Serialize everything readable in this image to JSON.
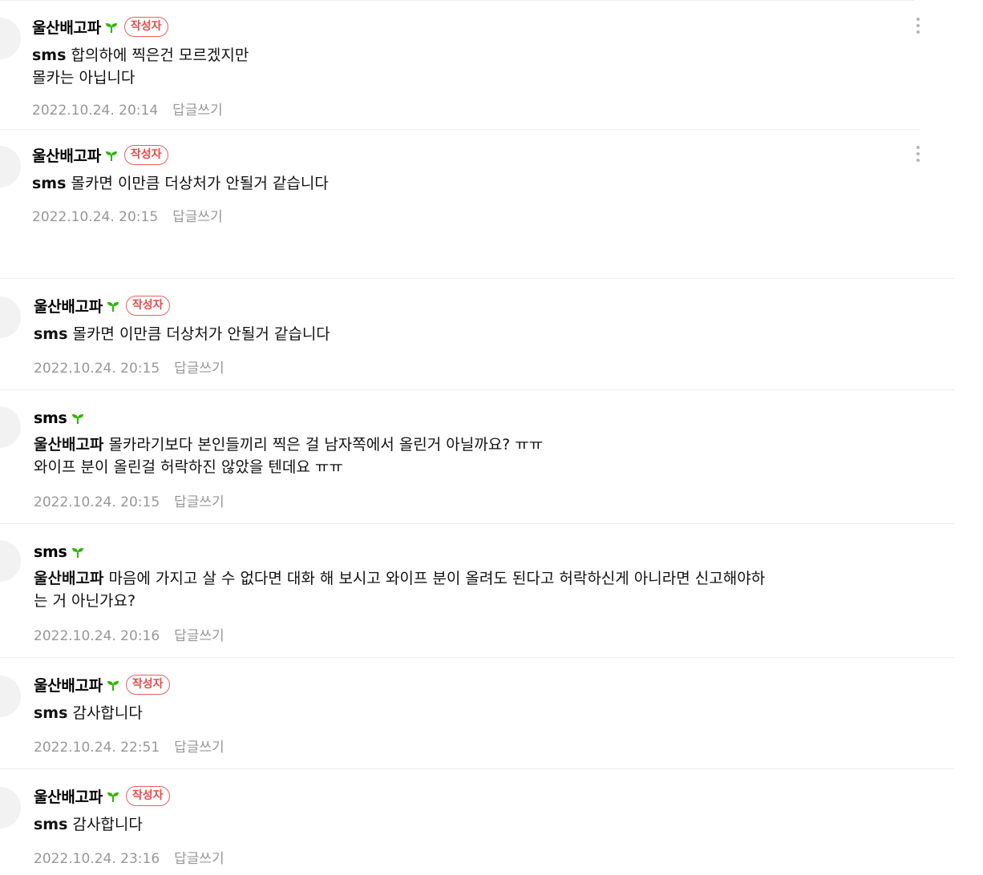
{
  "author_badge": "작성자",
  "reply_label": "답글쓰기",
  "comments": [
    {
      "nickname": "울산배고파",
      "is_author": true,
      "mention": "sms",
      "lines": [
        "합의하에 찍은건 모르겠지만",
        "몰카는 아닙니다"
      ],
      "date": "2022.10.24. 20:14"
    },
    {
      "nickname": "울산배고파",
      "is_author": true,
      "mention": "sms",
      "lines": [
        "몰카면 이만큼 더상처가 안될거 같습니다"
      ],
      "date": "2022.10.24. 20:15"
    },
    {
      "nickname": "울산배고파",
      "is_author": true,
      "mention": "sms",
      "lines": [
        "몰카면 이만큼 더상처가 안될거 같습니다"
      ],
      "date": "2022.10.24. 20:15"
    },
    {
      "nickname": "sms",
      "is_author": false,
      "mention": "울산배고파",
      "lines": [
        "몰카라기보다 본인들끼리 찍은 걸 남자쪽에서 올린거 아닐까요? ㅠㅠ",
        "와이프 분이 올린걸 허락하진 않았을 텐데요 ㅠㅠ"
      ],
      "date": "2022.10.24. 20:15"
    },
    {
      "nickname": "sms",
      "is_author": false,
      "mention": "울산배고파",
      "lines": [
        "마음에 가지고 살 수 없다면 대화 해 보시고 와이프 분이 올려도 된다고 허락하신게 아니라면 신고해야하",
        "는 거 아닌가요?"
      ],
      "date": "2022.10.24. 20:16"
    },
    {
      "nickname": "울산배고파",
      "is_author": true,
      "mention": "sms",
      "lines": [
        "감사합니다"
      ],
      "date": "2022.10.24. 22:51"
    },
    {
      "nickname": "울산배고파",
      "is_author": true,
      "mention": "sms",
      "lines": [
        "감사합니다"
      ],
      "date": "2022.10.24. 23:16"
    }
  ],
  "colors": {
    "badge": "#e64a4a",
    "sprout": "#2db400",
    "meta": "#979797",
    "divider": "#ececec"
  }
}
